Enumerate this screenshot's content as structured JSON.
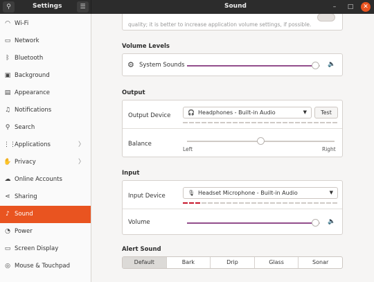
{
  "window": {
    "sidebar_title": "Settings",
    "content_title": "Sound",
    "search_icon": "search-icon",
    "menu_icon": "hamburger-menu-icon",
    "minimize": "–",
    "maximize": "□",
    "close": "✕"
  },
  "sidebar": {
    "items": [
      {
        "label": "Wi-Fi",
        "icon": "wifi-icon",
        "glyph": "◠"
      },
      {
        "label": "Network",
        "icon": "network-icon",
        "glyph": "▭"
      },
      {
        "label": "Bluetooth",
        "icon": "bluetooth-icon",
        "glyph": "ᛒ"
      },
      {
        "label": "Background",
        "icon": "background-icon",
        "glyph": "▣"
      },
      {
        "label": "Appearance",
        "icon": "appearance-icon",
        "glyph": "▤"
      },
      {
        "label": "Notifications",
        "icon": "bell-icon",
        "glyph": "♫"
      },
      {
        "label": "Search",
        "icon": "search-icon",
        "glyph": "⚲"
      },
      {
        "label": "Applications",
        "icon": "applications-icon",
        "glyph": "⋮⋮",
        "chevron": "〉"
      },
      {
        "label": "Privacy",
        "icon": "privacy-icon",
        "glyph": "✋",
        "chevron": "〉"
      },
      {
        "label": "Online Accounts",
        "icon": "online-accounts-icon",
        "glyph": "☁"
      },
      {
        "label": "Sharing",
        "icon": "sharing-icon",
        "glyph": "⋖"
      },
      {
        "label": "Sound",
        "icon": "music-note-icon",
        "glyph": "♪",
        "active": true
      },
      {
        "label": "Power",
        "icon": "power-icon",
        "glyph": "◔"
      },
      {
        "label": "Screen Display",
        "icon": "display-icon",
        "glyph": "▭"
      },
      {
        "label": "Mouse & Touchpad",
        "icon": "mouse-icon",
        "glyph": "◎"
      }
    ]
  },
  "content": {
    "top_partial_text": "quality; it is better to increase application volume settings, if possible.",
    "volume_levels": {
      "title": "Volume Levels",
      "system_sounds_label": "System Sounds",
      "system_sounds_level": 0.97
    },
    "output": {
      "title": "Output",
      "device_label": "Output Device",
      "device_value": "Headphones - Built-in Audio",
      "test_button": "Test",
      "balance_label": "Balance",
      "balance_left": "Left",
      "balance_right": "Right",
      "balance_value": 0.5
    },
    "input": {
      "title": "Input",
      "device_label": "Input Device",
      "device_value": "Headset Microphone - Built-in Audio",
      "volume_label": "Volume",
      "volume_level": 0.97
    },
    "alert": {
      "title": "Alert Sound",
      "options": [
        "Default",
        "Bark",
        "Drip",
        "Glass",
        "Sonar"
      ],
      "selected": "Default"
    }
  },
  "colors": {
    "accent": "#e95420",
    "slider_fill": "#924d8b",
    "input_level": "#c7162b"
  }
}
